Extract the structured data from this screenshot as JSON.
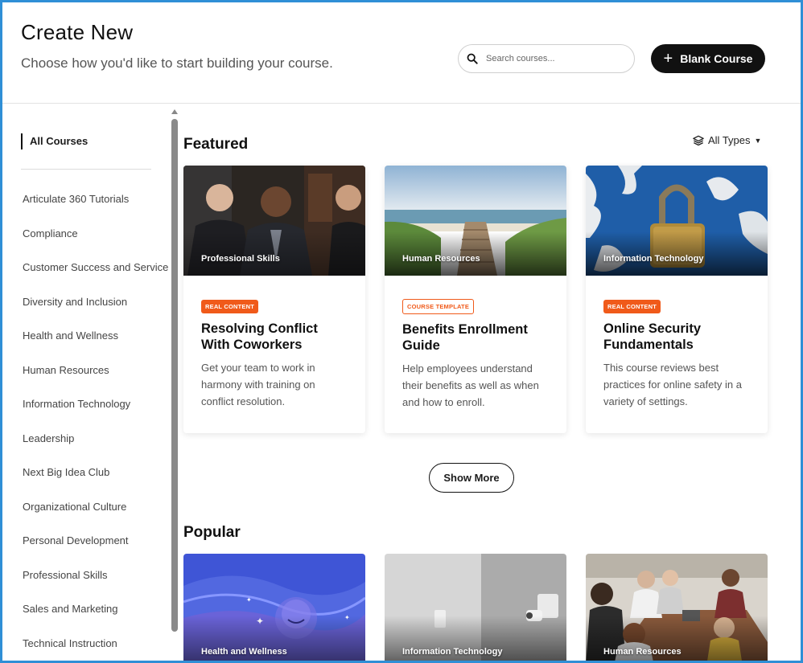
{
  "header": {
    "title": "Create New",
    "subtitle": "Choose how you'd like to start building your course.",
    "search_placeholder": "Search courses...",
    "blank_course_label": "Blank Course"
  },
  "sidebar": {
    "active": "All Courses",
    "items": [
      "Articulate 360 Tutorials",
      "Compliance",
      "Customer Success and Service",
      "Diversity and Inclusion",
      "Health and Wellness",
      "Human Resources",
      "Information Technology",
      "Leadership",
      "Next Big Idea Club",
      "Organizational Culture",
      "Personal Development",
      "Professional Skills",
      "Sales and Marketing",
      "Technical Instruction"
    ]
  },
  "featured": {
    "title": "Featured",
    "filter_label": "All Types",
    "cards": [
      {
        "category": "Professional Skills",
        "badge": "REAL CONTENT",
        "title": "Resolving Conflict With Coworkers",
        "description": "Get your team to work in harmony with training on conflict resolution."
      },
      {
        "category": "Human Resources",
        "badge": "COURSE TEMPLATE",
        "title": "Benefits Enrollment Guide",
        "description": "Help employees understand their benefits as well as when and how to enroll."
      },
      {
        "category": "Information Technology",
        "badge": "REAL CONTENT",
        "title": "Online Security Fundamentals",
        "description": "This course reviews best practices for online safety in a variety of settings."
      }
    ],
    "show_more_label": "Show More"
  },
  "popular": {
    "title": "Popular",
    "cards": [
      {
        "category": "Health and Wellness"
      },
      {
        "category": "Information Technology"
      },
      {
        "category": "Human Resources"
      }
    ]
  },
  "colors": {
    "accent": "#f05a1a",
    "frame": "#2f8fd6",
    "primary_button": "#111111"
  },
  "icons": {
    "search": "search-icon",
    "plus": "plus-icon",
    "layers": "layers-icon",
    "chevron": "chevron-down-icon"
  }
}
